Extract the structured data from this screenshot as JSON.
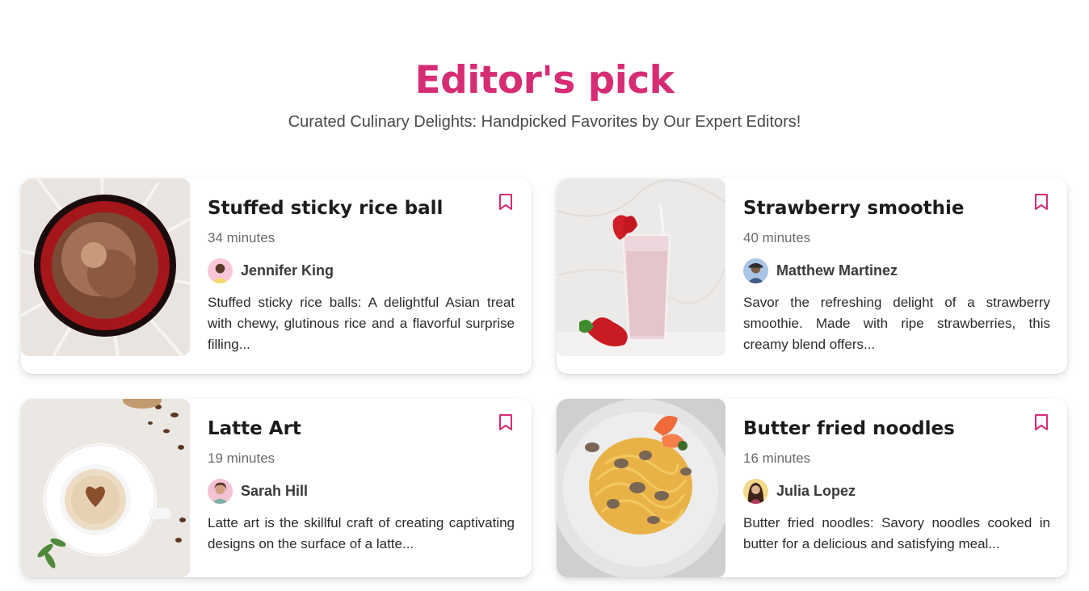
{
  "header": {
    "title": "Editor's pick",
    "subtitle": "Curated Culinary Delights: Handpicked Favorites by Our Expert Editors!"
  },
  "colors": {
    "accent": "#d62c74"
  },
  "cards": [
    {
      "title": "Stuffed sticky rice ball",
      "time": "34 minutes",
      "author": "Jennifer King",
      "description": "Stuffed sticky rice balls: A delightful Asian treat with chewy, glutinous rice and a flavorful surprise filling...",
      "image": "sticky-rice-dish-photo",
      "avatar": "jennifer-king-avatar"
    },
    {
      "title": "Strawberry smoothie",
      "time": "40 minutes",
      "author": "Matthew Martinez",
      "description": "Savor the refreshing delight of a strawberry smoothie. Made with ripe strawberries, this creamy blend offers...",
      "image": "strawberry-smoothie-photo",
      "avatar": "matthew-martinez-avatar"
    },
    {
      "title": "Latte Art",
      "time": "19 minutes",
      "author": "Sarah Hill",
      "description": "Latte art is the skillful craft of creating captivating designs on the surface of a latte...",
      "image": "latte-art-photo",
      "avatar": "sarah-hill-avatar"
    },
    {
      "title": "Butter fried noodles",
      "time": "16 minutes",
      "author": "Julia Lopez",
      "description": "Butter fried noodles: Savory noodles cooked in butter for a delicious and satisfying meal...",
      "image": "butter-noodles-photo",
      "avatar": "julia-lopez-avatar"
    }
  ]
}
